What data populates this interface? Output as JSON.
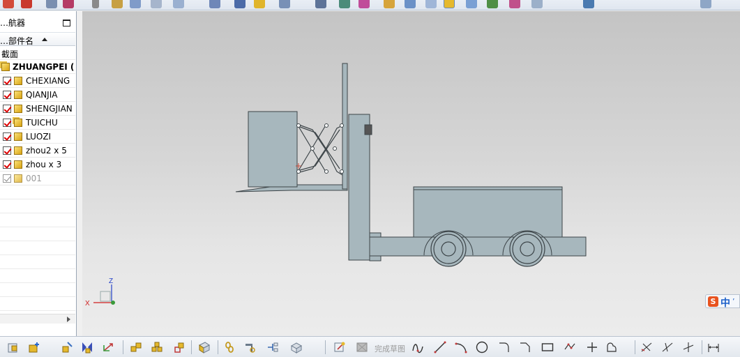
{
  "navigator": {
    "title": "…航器",
    "column_header": "…部件名",
    "section_label": "截面",
    "root_assembly": "ZHUANGPEI (",
    "items": [
      {
        "label": "CHEXIANG",
        "checked": true
      },
      {
        "label": "QIANJIA",
        "checked": true
      },
      {
        "label": "SHENGJIAN",
        "checked": true
      },
      {
        "label": "TUICHU",
        "checked": true
      },
      {
        "label": "LUOZI",
        "checked": true
      },
      {
        "label": "zhou2 x 5",
        "checked": true
      },
      {
        "label": "zhou x 3",
        "checked": true
      },
      {
        "label": "001",
        "checked": false
      }
    ]
  },
  "viewport": {
    "triad": {
      "x_label": "X",
      "z_label": "Z"
    },
    "model_colors": {
      "fill": "#a7b7bd",
      "stroke": "#3c4448",
      "background_top": "#c4c4c4",
      "background_bottom": "#ececec"
    }
  },
  "ime": {
    "logo": "S",
    "mode": "中",
    "extra": "’"
  },
  "bottom_toolbar": {
    "finish_sketch_label": "完成草图"
  },
  "icons": {
    "top": [
      "model-icon",
      "sketch-icon",
      "point-icon",
      "spline-icon",
      "feature-icon",
      "body-icon",
      "hole-icon",
      "pattern-icon",
      "bolt-icon",
      "spring-icon",
      "view-icon",
      "shade-icon",
      "render-icon",
      "light-icon",
      "layer-icon",
      "fit-icon",
      "zoom-icon",
      "rotate-icon",
      "pan-icon",
      "orient-icon",
      "background-icon",
      "image-icon",
      "display-icon",
      "section-icon",
      "window-icon",
      "exit-icon"
    ],
    "bottom": [
      "component-icon",
      "add-component-icon",
      "mirror-icon",
      "constraint-icon",
      "move-icon",
      "replace-icon",
      "explode-icon",
      "sequence-icon",
      "wave-icon",
      "sketch-icon",
      "finish-sketch-icon",
      "profile-icon",
      "line-icon",
      "arc-icon",
      "circle-icon",
      "fillet-icon",
      "chamfer-icon",
      "rectangle-icon",
      "polygon-icon",
      "point-icon",
      "offset-icon",
      "trim-icon",
      "extend-icon",
      "corner-icon",
      "dimension-icon"
    ]
  }
}
